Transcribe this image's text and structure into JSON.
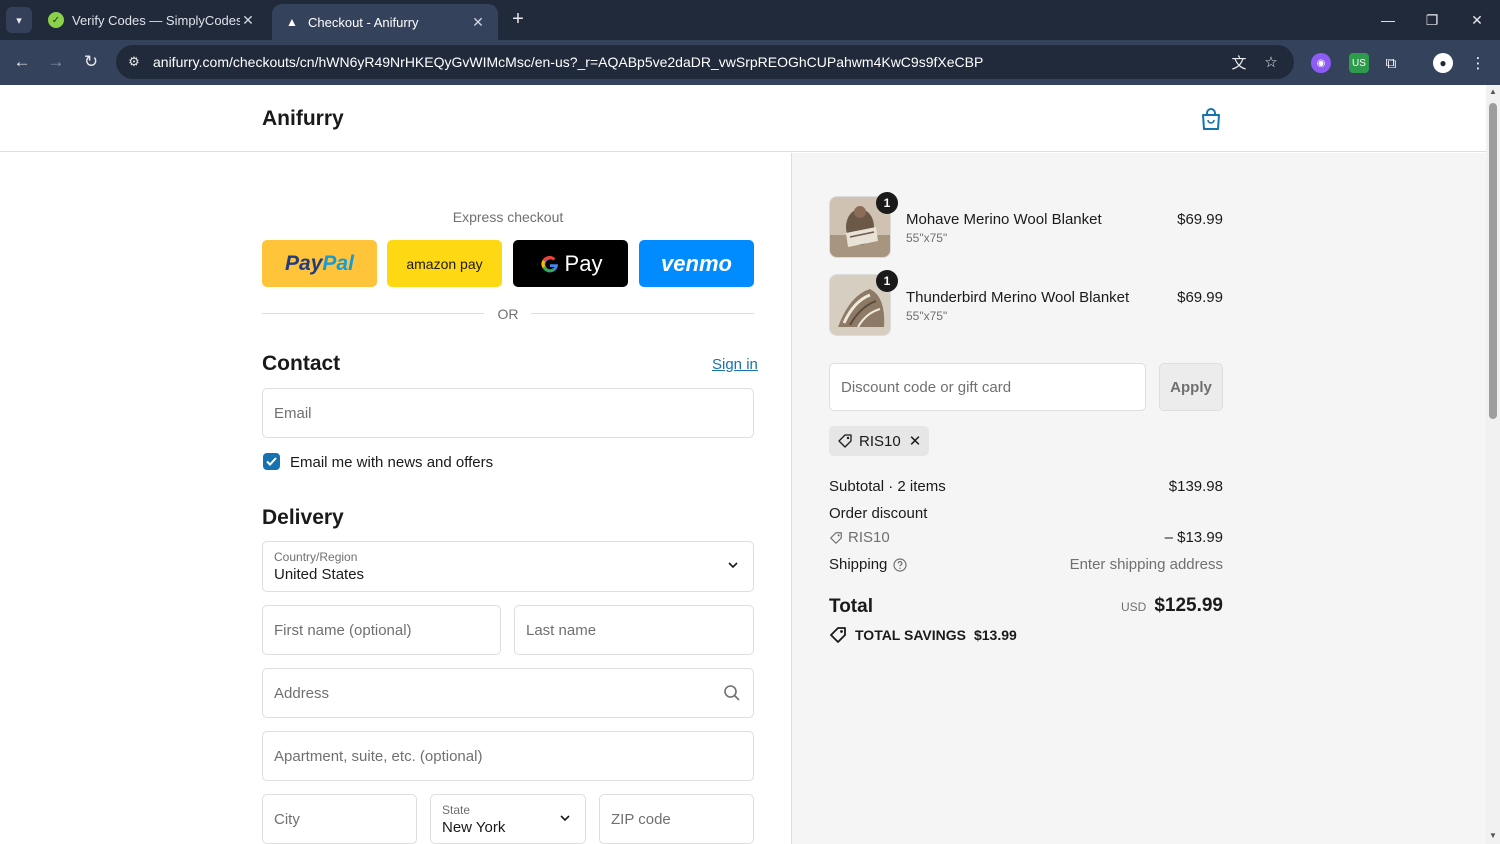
{
  "browser": {
    "tabs": [
      {
        "title": "Verify Codes — SimplyCodes",
        "favicon": "simplycodes-icon",
        "active": false
      },
      {
        "title": "Checkout - Anifurry",
        "favicon": "anifurry-icon",
        "active": true
      }
    ],
    "url": "anifurry.com/checkouts/cn/hWN6yR49NrHKEQyGvWIMcMsc/en-us?_r=AQABp5ve2daDR_vwSrpREOGhCUPahwm4KwC9s9fXeCBP"
  },
  "store": {
    "name": "Anifurry"
  },
  "express": {
    "title": "Express checkout",
    "buttons": [
      {
        "name": "PayPal",
        "color": "#ffc439"
      },
      {
        "name": "amazon pay",
        "color": "#ffd814"
      },
      {
        "name": "Pay",
        "color": "#000000"
      },
      {
        "name": "venmo",
        "color": "#008cff"
      }
    ],
    "separator": "OR"
  },
  "contact": {
    "title": "Contact",
    "sign_in": "Sign in",
    "email_placeholder": "Email",
    "newsletter_label": "Email me with news and offers",
    "newsletter_checked": true
  },
  "delivery": {
    "title": "Delivery",
    "country_label": "Country/Region",
    "country_value": "United States",
    "first_name_placeholder": "First name (optional)",
    "last_name_placeholder": "Last name",
    "address_placeholder": "Address",
    "apartment_placeholder": "Apartment, suite, etc. (optional)",
    "city_placeholder": "City",
    "state_label": "State",
    "state_value": "New York",
    "zip_placeholder": "ZIP code"
  },
  "summary": {
    "items": [
      {
        "name": "Mohave Merino Wool Blanket",
        "variant": "55\"x75\"",
        "price": "$69.99",
        "qty": "1"
      },
      {
        "name": "Thunderbird Merino Wool Blanket",
        "variant": "55\"x75\"",
        "price": "$69.99",
        "qty": "1"
      }
    ],
    "discount_placeholder": "Discount code or gift card",
    "apply_label": "Apply",
    "applied_code": "RIS10",
    "subtotal_label": "Subtotal · 2 items",
    "subtotal_value": "$139.98",
    "order_discount_label": "Order discount",
    "discount_code": "RIS10",
    "discount_value": "– $13.99",
    "shipping_label": "Shipping",
    "shipping_value": "Enter shipping address",
    "total_label": "Total",
    "total_currency": "USD",
    "total_value": "$125.99",
    "savings_label": "TOTAL SAVINGS",
    "savings_value": "$13.99"
  },
  "colors": {
    "accent": "#1773b0",
    "chrome_dark": "#202a3b",
    "chrome": "#35425c"
  }
}
